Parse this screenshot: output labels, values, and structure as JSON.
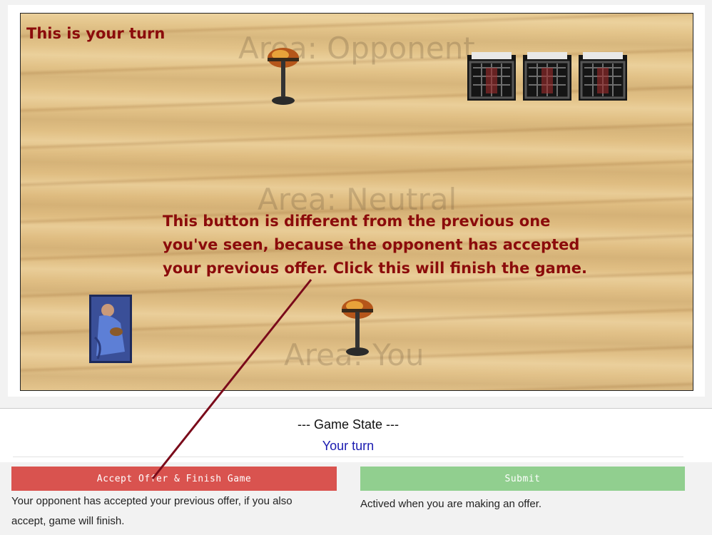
{
  "board": {
    "turn_label": "This is your turn",
    "areas": {
      "opponent": "Area: Opponent",
      "neutral": "Area: Neutral",
      "you": "Area: You"
    },
    "callout_text": "This button is different from the previous one you've seen, because the opponent has accepted your previous offer. Click this will finish the game.",
    "items": {
      "opponent": [
        "lamp-icon",
        "crate-icon",
        "crate-icon",
        "crate-icon"
      ],
      "you": [
        "painting-icon",
        "lamp-icon"
      ]
    }
  },
  "game_state": {
    "title": "--- Game State ---",
    "value": "Your turn"
  },
  "actions": {
    "accept_label": "Accept Offer & Finish Game",
    "accept_note": "Your opponent has accepted your previous offer, if you also accept, game will finish.",
    "submit_label": "Submit",
    "submit_note": "Actived when you are making an offer."
  },
  "colors": {
    "callout": "#8b0b0b",
    "accept_button": "#d9534f",
    "submit_button": "#91cf8f",
    "state_value": "#1b1bb0"
  }
}
